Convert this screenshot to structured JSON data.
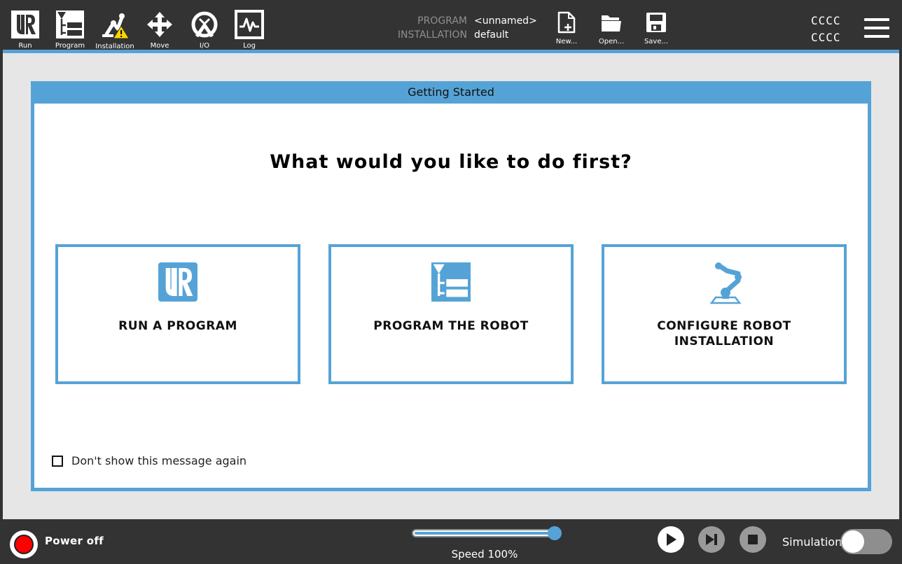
{
  "header": {
    "nav": [
      {
        "label": "Run",
        "icon": "ur-logo-icon"
      },
      {
        "label": "Program",
        "icon": "program-tree-icon"
      },
      {
        "label": "Installation",
        "icon": "robot-arm-warning-icon"
      },
      {
        "label": "Move",
        "icon": "move-arrows-icon"
      },
      {
        "label": "I/O",
        "icon": "io-icon"
      },
      {
        "label": "Log",
        "icon": "log-waveform-icon"
      }
    ],
    "program_key": "PROGRAM",
    "installation_key": "INSTALLATION",
    "program_value": "<unnamed>",
    "installation_value": "default",
    "file_buttons": [
      {
        "label": "New...",
        "icon": "new-file-icon"
      },
      {
        "label": "Open...",
        "icon": "open-folder-icon"
      },
      {
        "label": "Save...",
        "icon": "save-disk-icon"
      }
    ],
    "status_line1": "CCCC",
    "status_line2": "CCCC",
    "menu_icon": "hamburger-menu-icon"
  },
  "dialog": {
    "title": "Getting Started",
    "question": "What would you like to do first?",
    "choices": [
      {
        "label": "RUN A PROGRAM",
        "icon": "ur-logo-icon"
      },
      {
        "label": "PROGRAM THE ROBOT",
        "icon": "program-tree-icon"
      },
      {
        "label": "CONFIGURE ROBOT\nINSTALLATION",
        "icon": "robot-arm-icon"
      }
    ],
    "dont_show_label": "Don't show this message again",
    "dont_show_checked": false
  },
  "footer": {
    "power_label": "Power off",
    "speed_label": "Speed 100%",
    "speed_fraction": 1.0,
    "simulation_label": "Simulation",
    "simulation_on": false
  },
  "colors": {
    "accent": "#55a3d6",
    "dark_bar": "#333333",
    "content_bg": "#e6e6e6",
    "power_red": "#ff0000",
    "warning_yellow": "#ffd600"
  }
}
